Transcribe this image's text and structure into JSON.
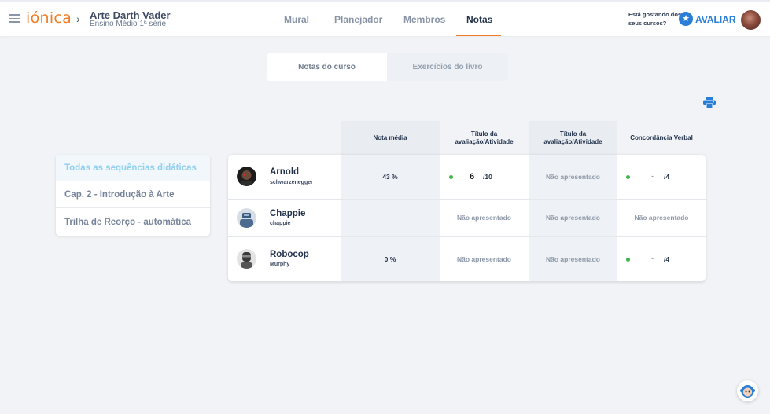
{
  "header": {
    "logo": "iónica",
    "course_title": "Arte Darth Vader",
    "course_subtitle": "Ensino Médio 1ª série",
    "nav": [
      "Mural",
      "Planejador",
      "Membros",
      "Notas"
    ],
    "active_nav": "Notas",
    "rate_prompt_line1": "Está gostando dos",
    "rate_prompt_line2": "seus cursos?",
    "rate_button": "AVALIAR"
  },
  "tabs": {
    "items": [
      "Notas do curso",
      "Exercícios do livro"
    ],
    "active": "Notas do curso"
  },
  "sidebar": {
    "items": [
      "Todas as sequências didáticas",
      "Cap. 2 - Introdução à Arte",
      "Trilha de Reorço - automática"
    ],
    "active": "Todas as sequências didáticas"
  },
  "table": {
    "columns": [
      "Nota média",
      "Título da avaliação/Atividade",
      "Título da avaliação/Atividade",
      "Concordância Verbal"
    ],
    "rows": [
      {
        "name": "Arnold",
        "username": "schwarzenegger",
        "avg": "43 %",
        "c1_grade": "6",
        "c1_max": "/10",
        "c2": "Não apresentado",
        "c3_grade": "-",
        "c3_max": "/4"
      },
      {
        "name": "Chappie",
        "username": "chappie",
        "avg": "",
        "c1": "Não apresentado",
        "c2": "Não apresentado",
        "c3": "Não apresentado"
      },
      {
        "name": "Robocop",
        "username": "Murphy",
        "avg": "0 %",
        "c1": "Não apresentado",
        "c2": "Não apresentado",
        "c3_grade": "-",
        "c3_max": "/4"
      }
    ]
  },
  "icons": {
    "menu": "hamburger-icon",
    "print": "printer-icon",
    "star": "star-icon",
    "help": "help-mascot-icon"
  },
  "colors": {
    "brand": "#f37c22",
    "accent": "#2a7ed8",
    "status_dot": "#3bb84a"
  }
}
